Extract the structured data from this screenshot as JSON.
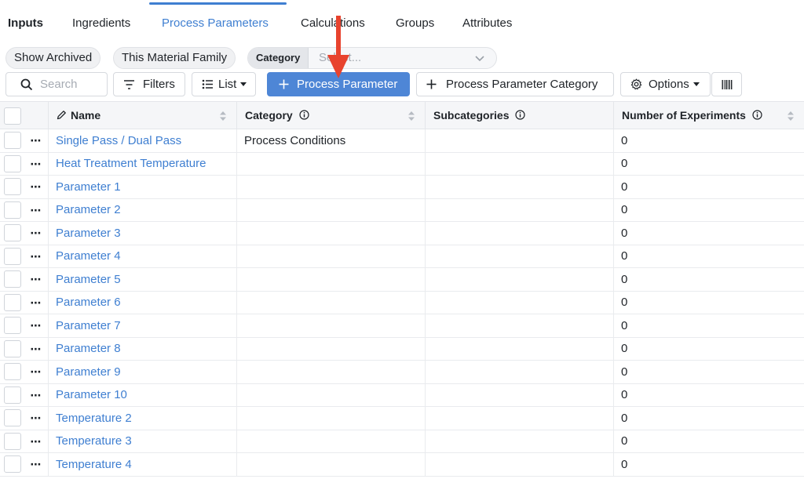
{
  "tabs": {
    "section": "Inputs",
    "items": [
      "Ingredients",
      "Process Parameters",
      "Calculations",
      "Groups",
      "Attributes"
    ],
    "active": "Process Parameters"
  },
  "filters": {
    "show_archived": "Show Archived",
    "this_family": "This Material Family",
    "category_label": "Category",
    "category_placeholder": "Select..."
  },
  "toolbar": {
    "search_placeholder": "Search",
    "filters": "Filters",
    "list": "List",
    "add_parameter": "Process Parameter",
    "add_category": "Process Parameter Category",
    "options": "Options"
  },
  "table": {
    "columns": {
      "name": "Name",
      "category": "Category",
      "subcategories": "Subcategories",
      "experiments": "Number of Experiments"
    },
    "rows": [
      {
        "name": "Single Pass / Dual Pass",
        "category": "Process Conditions",
        "subcategories": "",
        "experiments": "0"
      },
      {
        "name": "Heat Treatment Temperature",
        "category": "",
        "subcategories": "",
        "experiments": "0"
      },
      {
        "name": "Parameter 1",
        "category": "",
        "subcategories": "",
        "experiments": "0"
      },
      {
        "name": "Parameter 2",
        "category": "",
        "subcategories": "",
        "experiments": "0"
      },
      {
        "name": "Parameter 3",
        "category": "",
        "subcategories": "",
        "experiments": "0"
      },
      {
        "name": "Parameter 4",
        "category": "",
        "subcategories": "",
        "experiments": "0"
      },
      {
        "name": "Parameter 5",
        "category": "",
        "subcategories": "",
        "experiments": "0"
      },
      {
        "name": "Parameter 6",
        "category": "",
        "subcategories": "",
        "experiments": "0"
      },
      {
        "name": "Parameter 7",
        "category": "",
        "subcategories": "",
        "experiments": "0"
      },
      {
        "name": "Parameter 8",
        "category": "",
        "subcategories": "",
        "experiments": "0"
      },
      {
        "name": "Parameter 9",
        "category": "",
        "subcategories": "",
        "experiments": "0"
      },
      {
        "name": "Parameter 10",
        "category": "",
        "subcategories": "",
        "experiments": "0"
      },
      {
        "name": "Temperature 2",
        "category": "",
        "subcategories": "",
        "experiments": "0"
      },
      {
        "name": "Temperature 3",
        "category": "",
        "subcategories": "",
        "experiments": "0"
      },
      {
        "name": "Temperature 4",
        "category": "",
        "subcategories": "",
        "experiments": "0"
      }
    ]
  },
  "colors": {
    "accent": "#3f7fd1",
    "primary_button": "#4e86d6",
    "arrow": "#e8432e"
  },
  "icons": [
    "search-icon",
    "filter-icon",
    "list-icon",
    "plus-icon",
    "gear-icon",
    "barcode-icon",
    "pencil-icon",
    "info-icon",
    "sort-icon",
    "chevron-down-icon",
    "ellipsis-icon"
  ]
}
